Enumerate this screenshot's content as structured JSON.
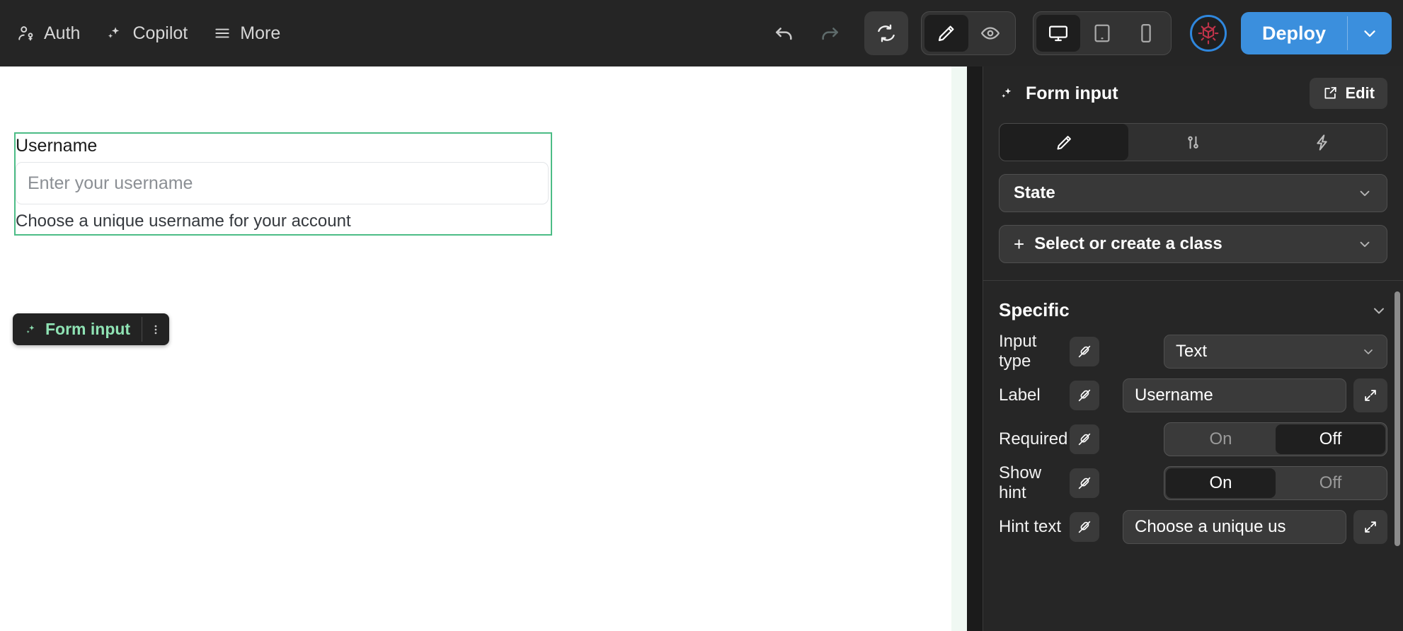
{
  "topbar": {
    "items": [
      {
        "label": "Auth",
        "icon": "user-auth-icon"
      },
      {
        "label": "Copilot",
        "icon": "sparkles-icon"
      },
      {
        "label": "More",
        "icon": "hamburger-icon"
      }
    ],
    "undo_icon": "undo-arrow-icon",
    "redo_icon": "redo-arrow-icon",
    "refresh_icon": "refresh-icon",
    "mode": {
      "edit_icon": "pencil-icon",
      "preview_icon": "eye-icon",
      "active": "edit"
    },
    "viewport": {
      "desktop_icon": "desktop-icon",
      "tablet_icon": "tablet-icon",
      "mobile_icon": "mobile-icon",
      "active": "desktop"
    },
    "logo_icon": "cube-logo-icon",
    "deploy_label": "Deploy",
    "deploy_caret_icon": "chevron-down-icon",
    "deploy_color": "#3b8fdd"
  },
  "canvas": {
    "selection_color": "#4cbc86",
    "field": {
      "label": "Username",
      "placeholder": "Enter your username",
      "hint": "Choose a unique username for your account"
    },
    "badge": {
      "label": "Form input",
      "icon": "sparkles-icon",
      "menu_icon": "kebab-menu-icon"
    }
  },
  "panel": {
    "title": "Form input",
    "title_icon": "sparkles-icon",
    "edit_label": "Edit",
    "edit_icon": "external-edit-icon",
    "tabs": [
      {
        "name": "style",
        "icon": "pencil-icon",
        "active": true
      },
      {
        "name": "settings",
        "icon": "sliders-icon",
        "active": false
      },
      {
        "name": "interactions",
        "icon": "lightning-icon",
        "active": false
      }
    ],
    "state_label": "State",
    "state_chevron": "chevron-down-icon",
    "class_label": "Select or create a class",
    "class_plus": "+",
    "class_chevron": "chevron-down-icon",
    "specific": {
      "title": "Specific",
      "chevron": "chevron-down-icon",
      "rows": [
        {
          "label": "Input type",
          "plug_icon": "plug-disconnected-icon",
          "control": "select",
          "value": "Text",
          "chevron": "chevron-down-icon"
        },
        {
          "label": "Label",
          "plug_icon": "plug-disconnected-icon",
          "control": "text",
          "value": "Username",
          "expand_icon": "expand-diagonal-icon"
        },
        {
          "label": "Required",
          "plug_icon": "plug-disconnected-icon",
          "control": "toggle",
          "on_label": "On",
          "off_label": "Off",
          "value": "Off"
        },
        {
          "label": "Show hint",
          "plug_icon": "plug-disconnected-icon",
          "control": "toggle",
          "on_label": "On",
          "off_label": "Off",
          "value": "On"
        },
        {
          "label": "Hint text",
          "plug_icon": "plug-disconnected-icon",
          "control": "text",
          "value": "Choose a unique us",
          "expand_icon": "expand-diagonal-icon"
        }
      ]
    }
  }
}
